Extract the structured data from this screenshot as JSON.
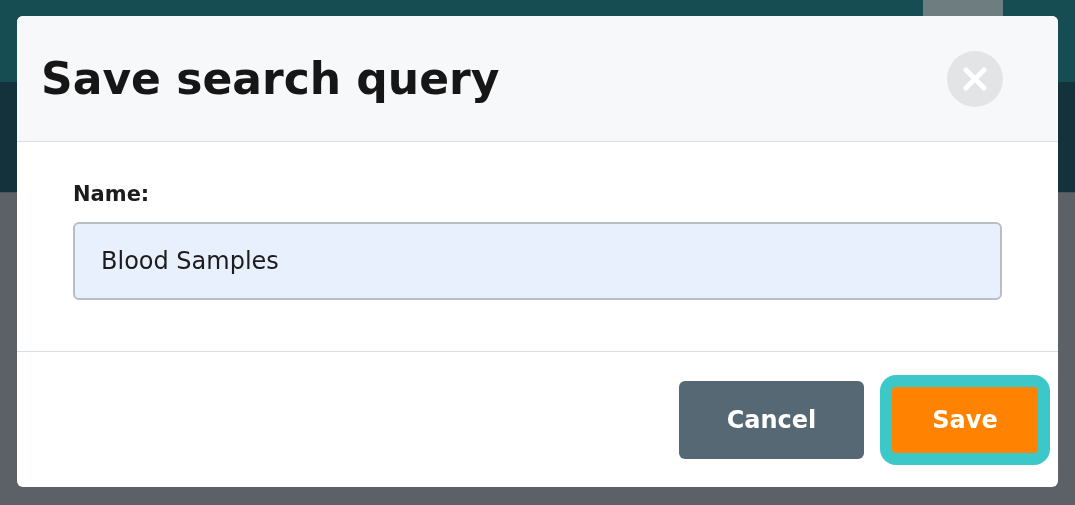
{
  "dialog": {
    "title": "Save search query",
    "field": {
      "label": "Name:",
      "value": "Blood Samples"
    },
    "buttons": [
      {
        "label": "Cancel",
        "kind": "secondary",
        "focused": false
      },
      {
        "label": "Save",
        "kind": "primary",
        "focused": true
      }
    ]
  }
}
